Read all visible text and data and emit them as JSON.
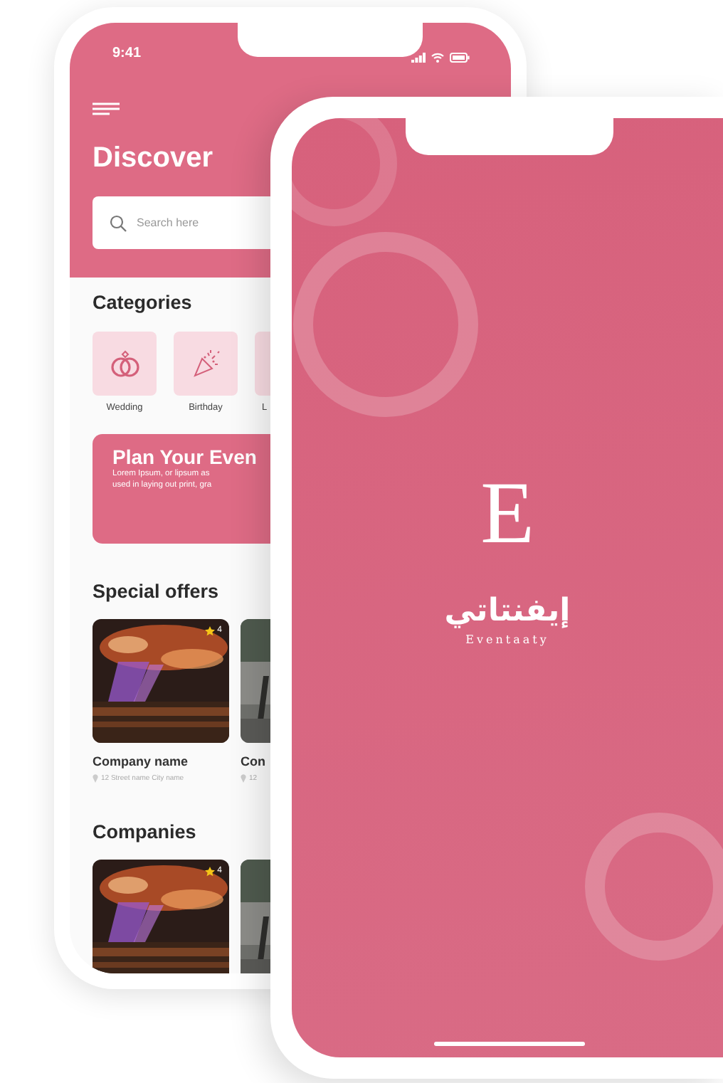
{
  "home_screen": {
    "status_time": "9:41",
    "title": "Discover",
    "search": {
      "placeholder": "Search here"
    },
    "categories_heading": "Categories",
    "categories": [
      {
        "label": "Wedding"
      },
      {
        "label": "Birthday"
      },
      {
        "label": "L"
      }
    ],
    "promo": {
      "title": "Plan Your Even",
      "lines": [
        "Lorem Ipsum, or lipsum as",
        "used in laying out print, gra"
      ]
    },
    "special_offers_heading": "Special offers",
    "special_offers": [
      {
        "name": "Company name",
        "address": "12 Street name City name",
        "rating": "4"
      },
      {
        "name": "Con",
        "address": "12"
      }
    ],
    "companies_heading": "Companies",
    "companies": [
      {
        "kind": "picture",
        "rating": "4"
      },
      {
        "kind": "picture"
      }
    ]
  },
  "splash_screen": {
    "logo_letter": "E",
    "app_name_arabic": "إيفنتاتي",
    "app_name": "Eventaaty"
  }
}
